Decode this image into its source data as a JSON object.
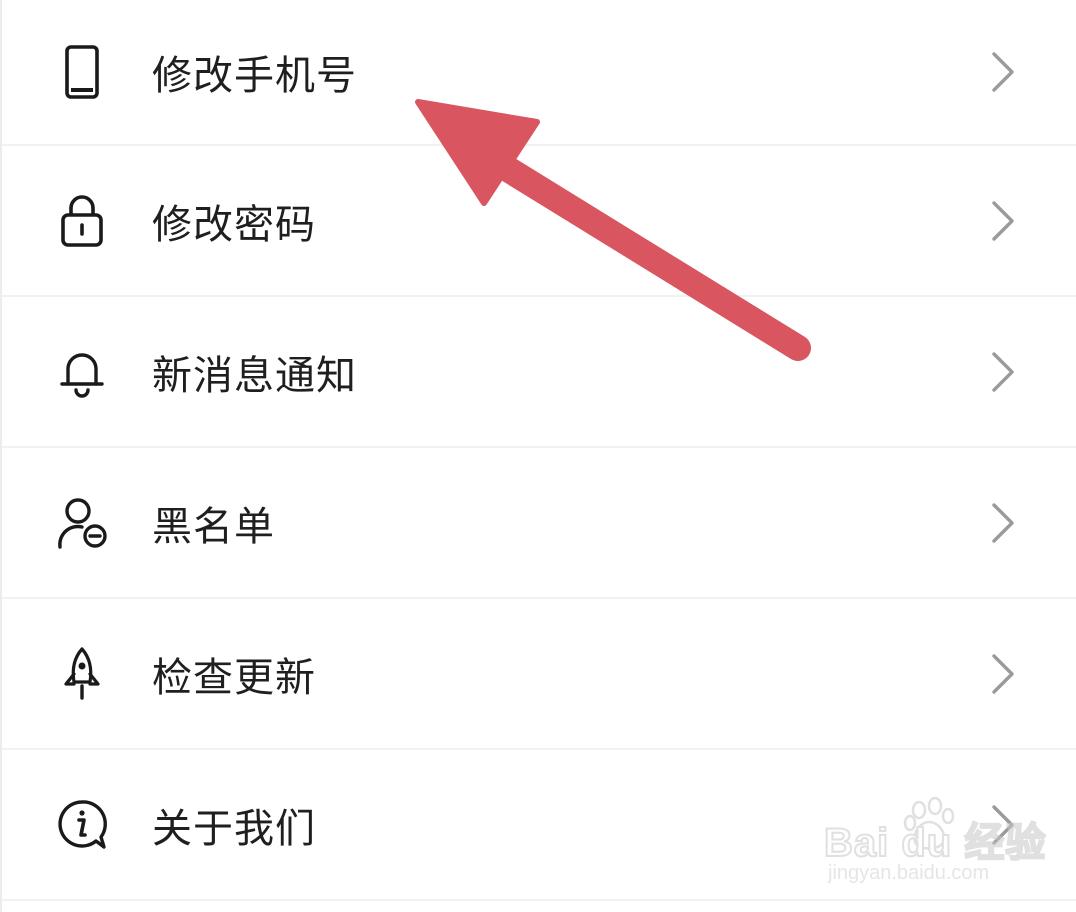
{
  "menu": {
    "items": [
      {
        "label": "修改手机号",
        "icon": "phone-icon"
      },
      {
        "label": "修改密码",
        "icon": "lock-icon"
      },
      {
        "label": "新消息通知",
        "icon": "bell-icon"
      },
      {
        "label": "黑名单",
        "icon": "user-block-icon"
      },
      {
        "label": "检查更新",
        "icon": "rocket-icon"
      },
      {
        "label": "关于我们",
        "icon": "info-icon"
      }
    ]
  },
  "annotation": {
    "arrow_color": "#d9555f",
    "points_to": "修改手机号"
  },
  "watermark": {
    "brand": "Bai du 经验",
    "url": "jingyan.baidu.com"
  }
}
